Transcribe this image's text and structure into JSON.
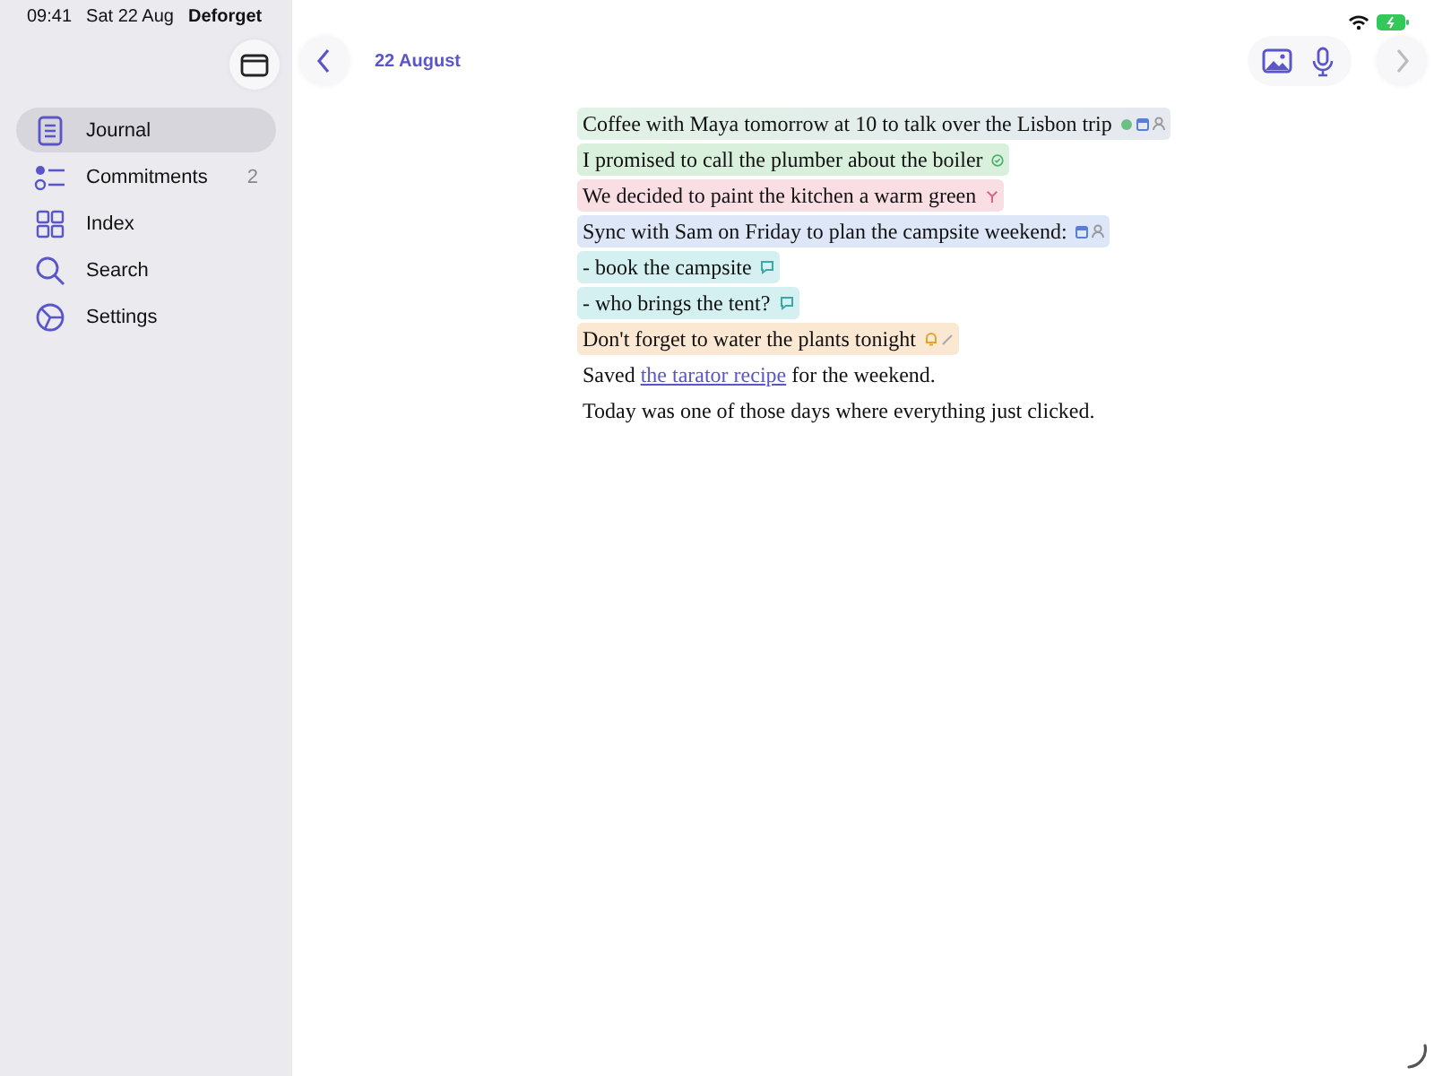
{
  "status_bar": {
    "time": "09:41",
    "date": "Sat 22 Aug",
    "app": "Deforget"
  },
  "sidebar": {
    "items": [
      {
        "label": "Journal",
        "kind": "journal",
        "selected": true
      },
      {
        "label": "Commitments",
        "kind": "commitments",
        "selected": false,
        "count": "2"
      },
      {
        "label": "Index",
        "kind": "index",
        "selected": false
      },
      {
        "label": "Search",
        "kind": "search",
        "selected": false
      },
      {
        "label": "Settings",
        "kind": "settings",
        "selected": false
      }
    ]
  },
  "toolbar": {
    "title": "22 August"
  },
  "entries": [
    {
      "kind": "event",
      "text": "Coffee with Maya tomorrow at 10 to talk over the Lisbon trip"
    },
    {
      "kind": "commitment",
      "text": "I promised to call the plumber about the boiler"
    },
    {
      "kind": "decision",
      "text": "We decided to paint the kitchen a warm green"
    },
    {
      "kind": "meeting",
      "text": "Sync with Sam on Friday to plan the campsite weekend:"
    },
    {
      "kind": "note",
      "text": "- book the campsite"
    },
    {
      "kind": "note",
      "text": "- who brings the tent?"
    },
    {
      "kind": "reminder",
      "text": "Don't forget to water the plants tonight"
    },
    {
      "kind": "link",
      "text": "Saved ",
      "link": "the tarator recipe",
      "after": " for the weekend."
    },
    {
      "kind": "plain",
      "text": "Today was one of those days where everything just clicked."
    }
  ]
}
